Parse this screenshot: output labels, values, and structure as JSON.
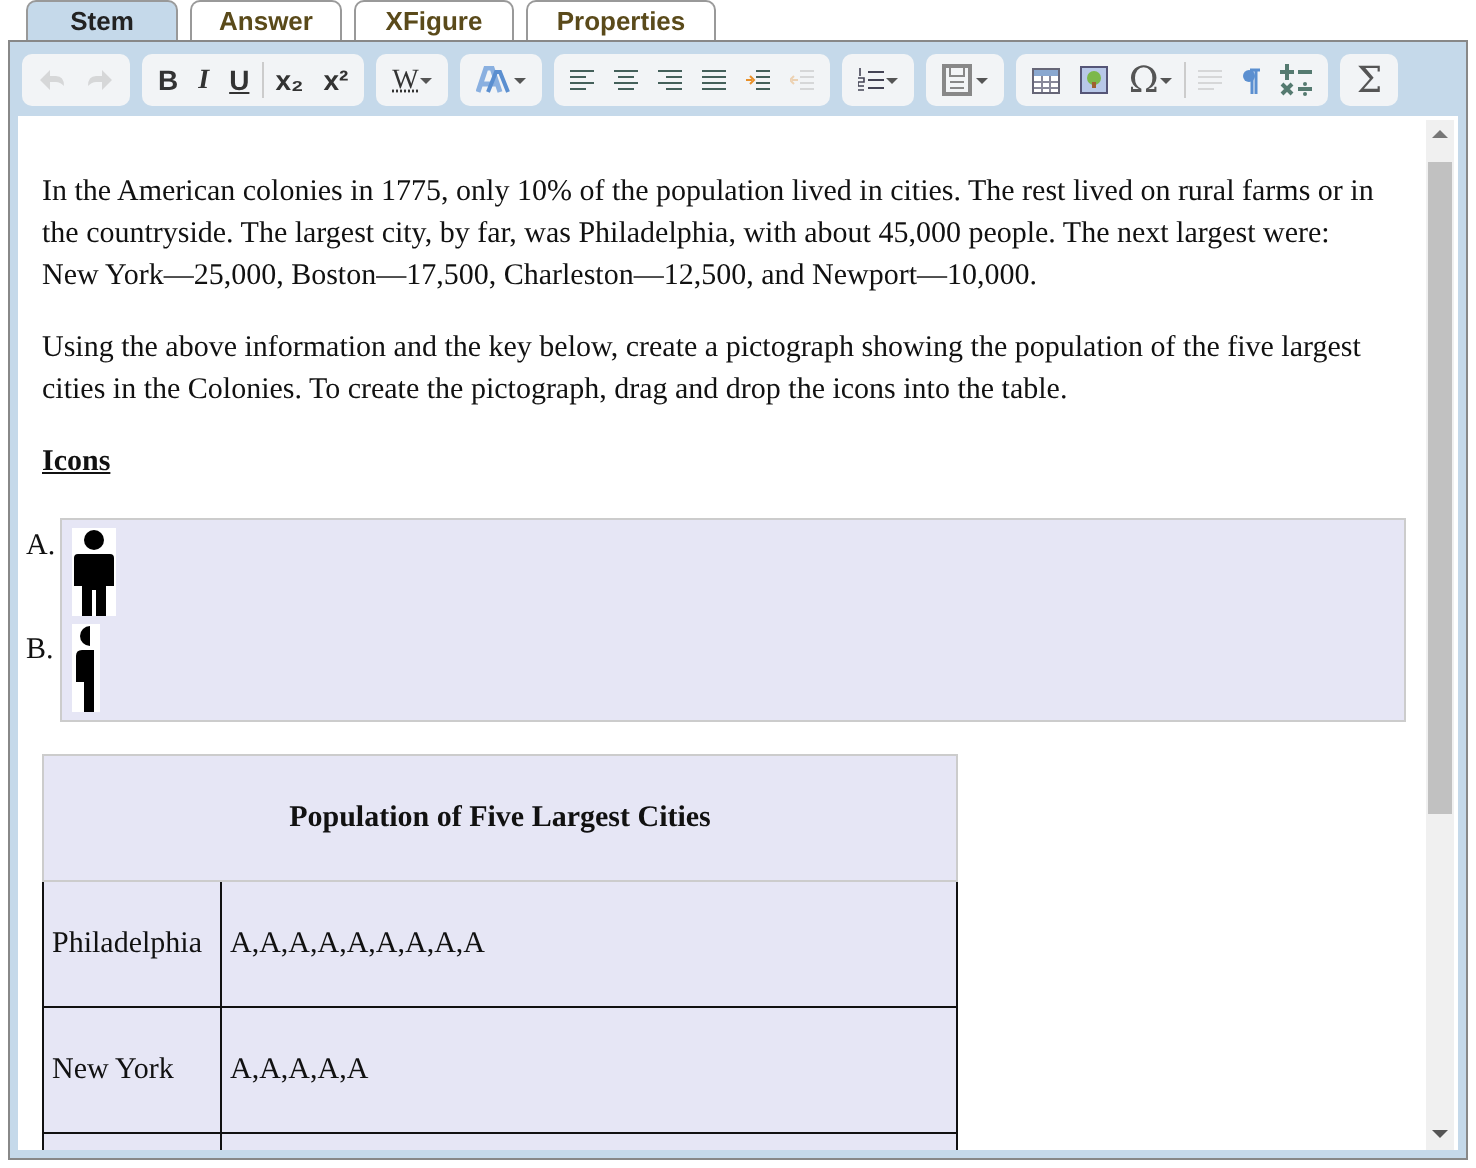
{
  "tabs": [
    {
      "label": "Stem",
      "selected": true
    },
    {
      "label": "Answer",
      "selected": false
    },
    {
      "label": "XFigure",
      "selected": false
    },
    {
      "label": "Properties",
      "selected": false
    }
  ],
  "toolbar": [
    [
      {
        "kind": "undo",
        "disabled": true
      },
      {
        "kind": "redo",
        "disabled": true
      }
    ],
    [
      {
        "kind": "bold",
        "glyph": "B"
      },
      {
        "kind": "italic",
        "glyph": "I"
      },
      {
        "kind": "underline",
        "glyph": "U"
      },
      {
        "kind": "separator"
      },
      {
        "kind": "script",
        "glyph": "x₂"
      },
      {
        "kind": "script",
        "glyph": "x²"
      }
    ],
    [
      {
        "kind": "dotted",
        "glyph": "W",
        "dropdown": true
      }
    ],
    [
      {
        "kind": "font-color",
        "dropdown": true
      }
    ],
    [
      {
        "kind": "align-left"
      },
      {
        "kind": "align-center"
      },
      {
        "kind": "align-right"
      },
      {
        "kind": "justify"
      },
      {
        "kind": "indent"
      },
      {
        "kind": "outdent",
        "disabled": true
      }
    ],
    [
      {
        "kind": "list",
        "dropdown": true
      }
    ],
    [
      {
        "kind": "form",
        "dropdown": true
      }
    ],
    [
      {
        "kind": "table"
      },
      {
        "kind": "image"
      },
      {
        "kind": "symbol",
        "glyph": "Ω",
        "dropdown": true
      },
      {
        "kind": "separator"
      },
      {
        "kind": "paragraph",
        "disabled": true
      },
      {
        "kind": "pilcrow"
      },
      {
        "kind": "operators"
      }
    ],
    [
      {
        "kind": "symbol",
        "glyph": "Σ"
      }
    ]
  ],
  "paragraphs": [
    "In the American colonies in 1775, only 10% of the population lived in cities. The rest lived on rural farms or in the countryside. The largest city, by far, was Philadelphia, with about 45,000 people. The next largest were: New York—25,000, Boston—17,500, Charleston—12,500, and Newport—10,000.",
    "Using the above information and the key below, create a pictograph showing the population of the five largest cities in the Colonies. To create the pictograph, drag and drop the icons into the table."
  ],
  "icons_heading": "Icons",
  "icons": [
    {
      "label": "A.",
      "kind": "full-person"
    },
    {
      "label": "B.",
      "kind": "half-person"
    }
  ],
  "table": {
    "title": "Population of Five Largest Cities",
    "rows": [
      {
        "city": "Philadelphia",
        "icons": "A,A,A,A,A,A,A,A,A"
      },
      {
        "city": "New York",
        "icons": "A,A,A,A,A"
      }
    ]
  }
}
